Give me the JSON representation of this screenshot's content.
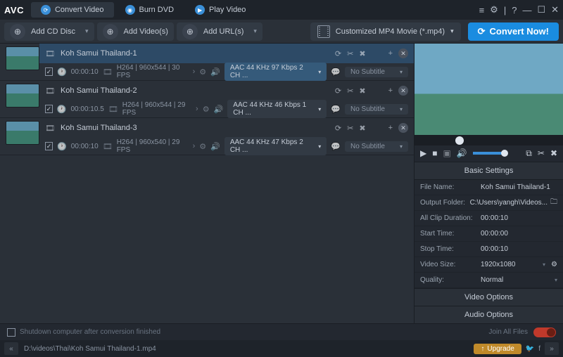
{
  "app": {
    "logo": "AVC"
  },
  "tabs": [
    {
      "label": "Convert Video",
      "icon_name": "refresh-icon"
    },
    {
      "label": "Burn DVD",
      "icon_name": "disc-icon"
    },
    {
      "label": "Play Video",
      "icon_name": "play-icon"
    }
  ],
  "toolbar": {
    "add_cd": "Add CD Disc",
    "add_videos": "Add Video(s)",
    "add_urls": "Add URL(s)",
    "output_profile": "Customized MP4 Movie (*.mp4)",
    "convert": "Convert Now!"
  },
  "items": [
    {
      "title": "Koh Samui Thailand-1",
      "duration": "00:00:10",
      "codec": "H264 | 960x544 | 30 FPS",
      "audio": "AAC 44 KHz 97 Kbps 2 CH ...",
      "subtitle": "No Subtitle",
      "selected": true
    },
    {
      "title": "Koh Samui Thailand-2",
      "duration": "00:00:10.5",
      "codec": "H264 | 960x544 | 29 FPS",
      "audio": "AAC 44 KHz 46 Kbps 1 CH ...",
      "subtitle": "No Subtitle",
      "selected": false
    },
    {
      "title": "Koh Samui Thailand-3",
      "duration": "00:00:10",
      "codec": "H264 | 960x540 | 29 FPS",
      "audio": "AAC 44 KHz 47 Kbps 2 CH ...",
      "subtitle": "No Subtitle",
      "selected": false
    }
  ],
  "settings": {
    "header": "Basic Settings",
    "rows": {
      "filename_k": "File Name:",
      "filename_v": "Koh Samui Thailand-1",
      "folder_k": "Output Folder:",
      "folder_v": "C:\\Users\\yangh\\Videos...",
      "clipdur_k": "All Clip Duration:",
      "clipdur_v": "00:00:10",
      "start_k": "Start Time:",
      "start_v": "00:00:00",
      "stop_k": "Stop Time:",
      "stop_v": "00:00:10",
      "vsize_k": "Video Size:",
      "vsize_v": "1920x1080",
      "quality_k": "Quality:",
      "quality_v": "Normal"
    },
    "video_options": "Video Options",
    "audio_options": "Audio Options"
  },
  "footer": {
    "shutdown": "Shutdown computer after conversion finished",
    "join": "Join All Files",
    "path": "D:\\videos\\Thai\\Koh Samui Thailand-1.mp4",
    "upgrade": "Upgrade"
  }
}
